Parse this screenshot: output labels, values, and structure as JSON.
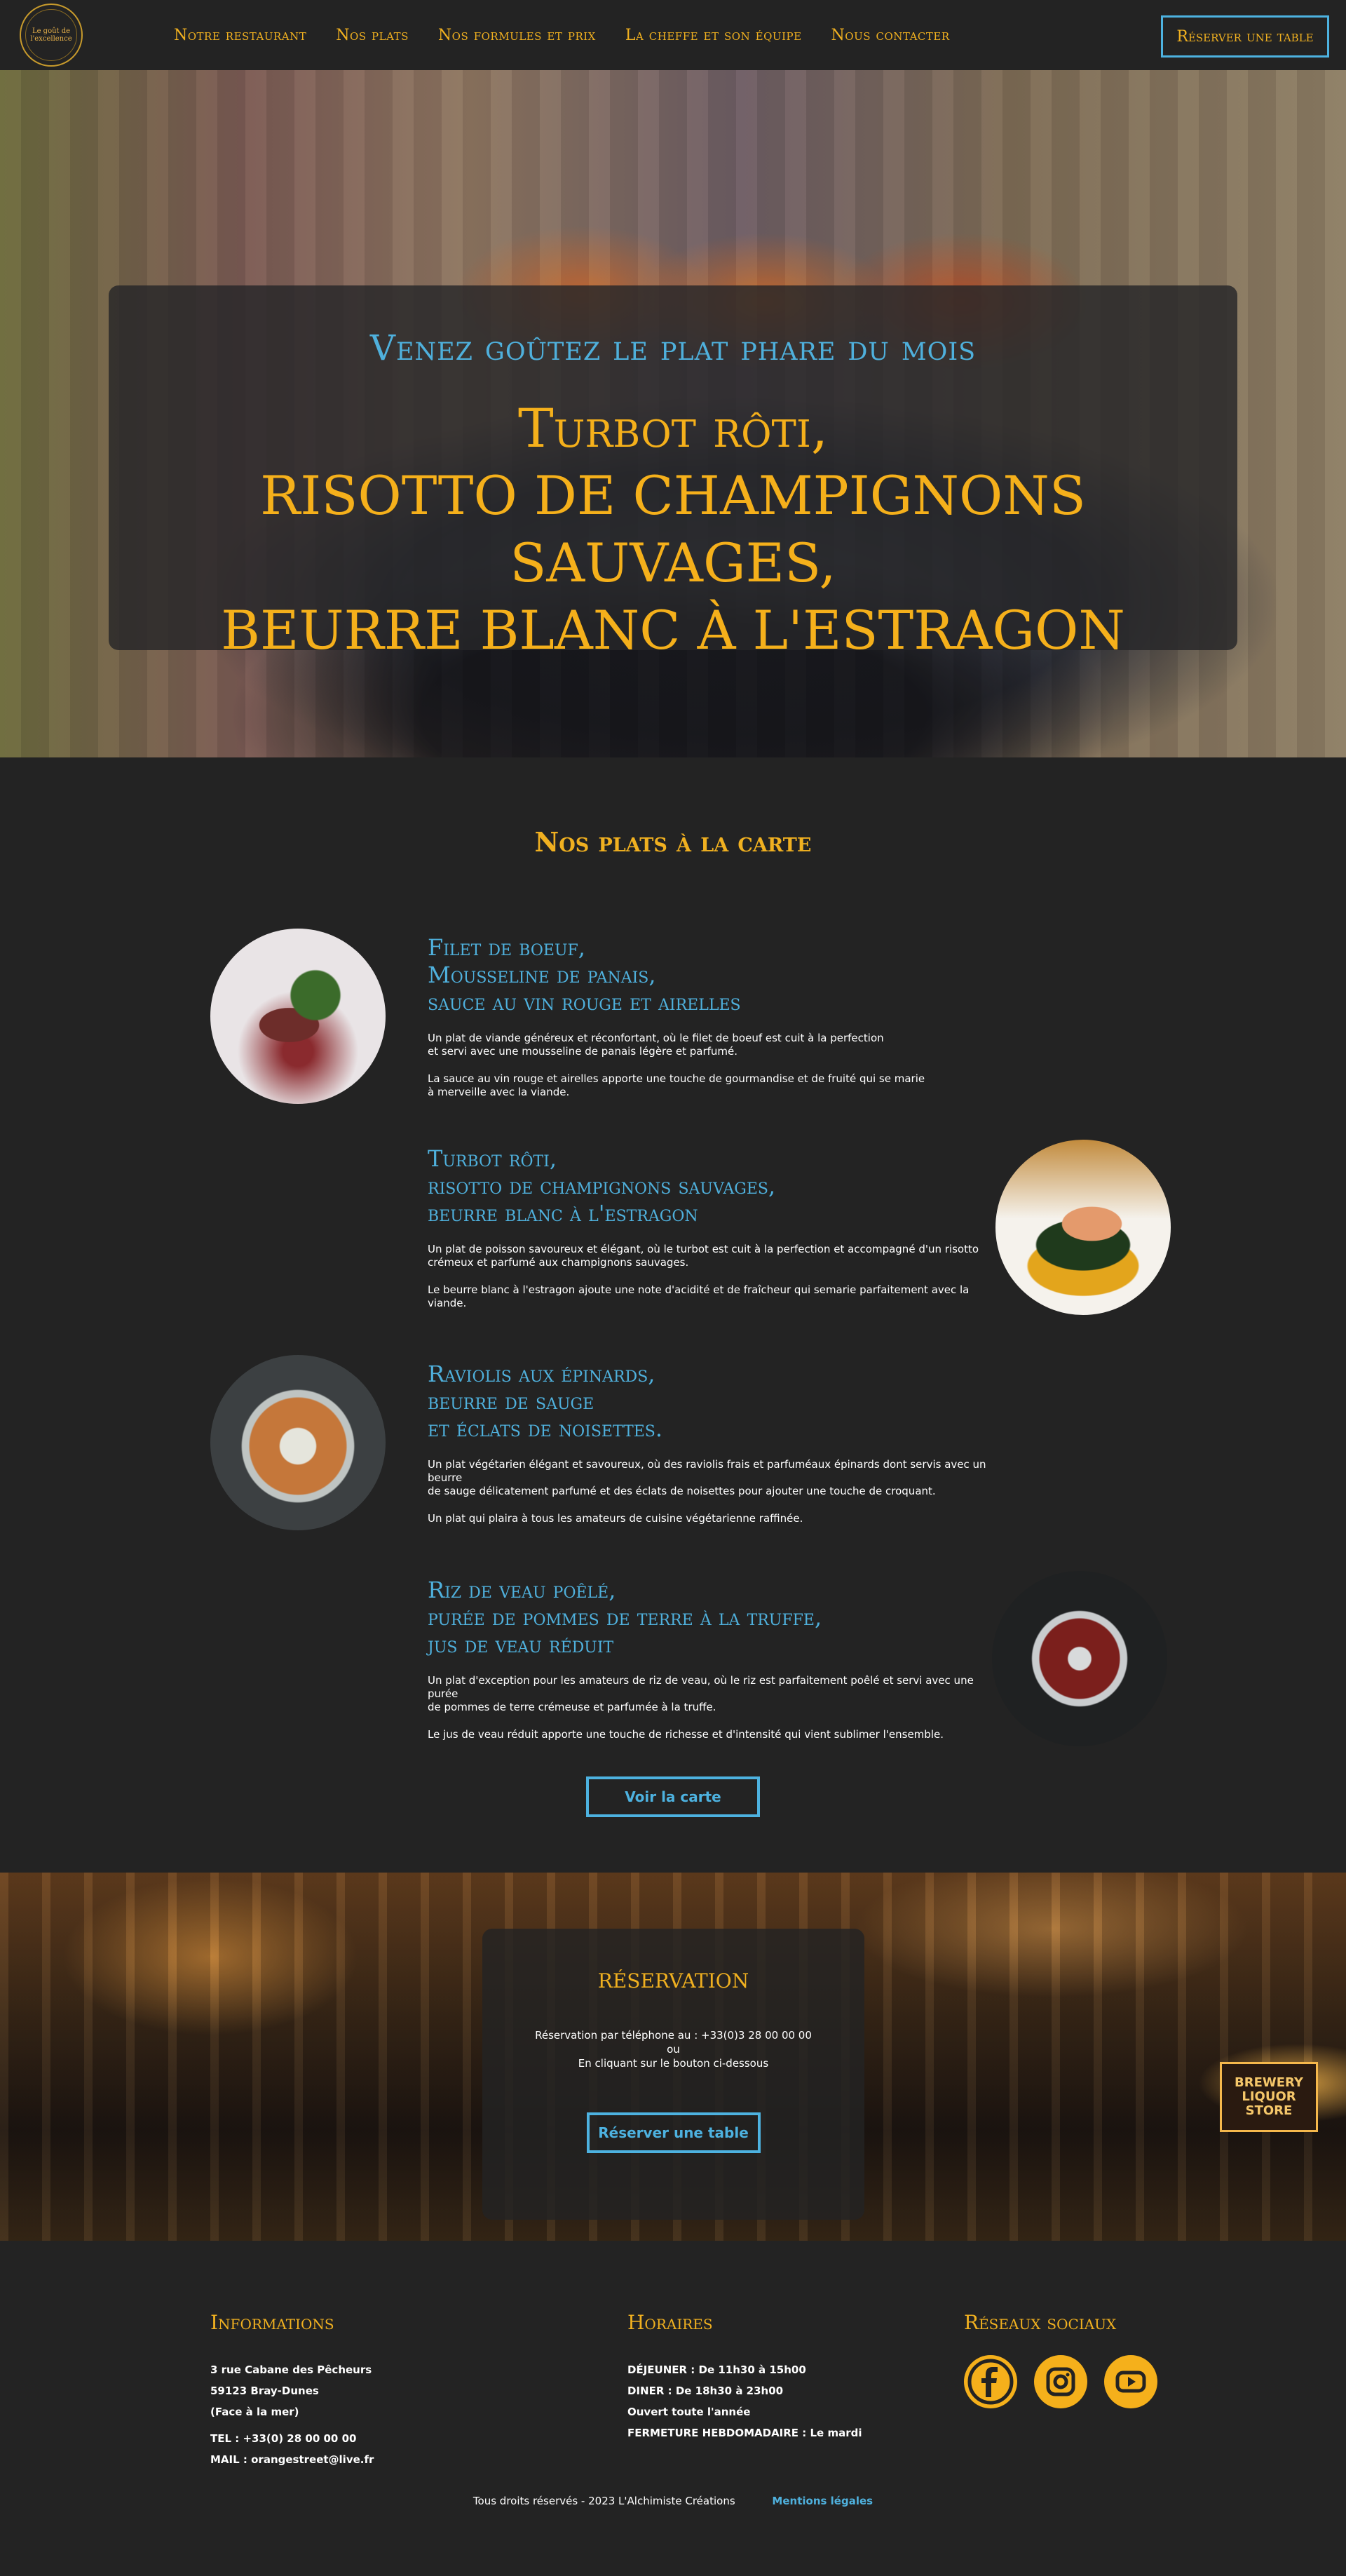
{
  "nav": {
    "logo_line1": "Le goût de",
    "logo_line2": "l'excellence",
    "links": [
      "Notre restaurant",
      "Nos plats",
      "Nos formules et prix",
      "La cheffe et son équipe",
      "Nous contacter"
    ],
    "cta": "Réserver une table"
  },
  "hero": {
    "subtitle": "Venez goûtez le plat phare du mois",
    "title_line1": "Turbot rôti,",
    "title_line2": "RISOTTO DE CHAMPIGNONS SAUVAGES,",
    "title_line3": "BEURRE BLANC À L'ESTRAGON"
  },
  "dishes": {
    "title": "Nos plats à la carte",
    "items": [
      {
        "name_line1": "Filet de boeuf,",
        "name_line2": "Mousseline de panais,",
        "name_line3": "sauce au vin rouge et airelles",
        "desc1": "Un plat de viande généreux et réconfortant, où le filet de boeuf est cuit à la perfection\net servi avec une mousseline de panais légère et parfumé.",
        "desc2": "La sauce au vin rouge et airelles apporte une touche de gourmandise et de fruité qui se marie\nà merveille avec la viande."
      },
      {
        "name_line1": "Turbot rôti,",
        "name_line2": "risotto de champignons sauvages,",
        "name_line3": "beurre blanc à l'estragon",
        "desc1": "Un plat de poisson savoureux et élégant, où le turbot est cuit à la perfection et accompagné d'un risotto\ncrémeux et parfumé aux champignons sauvages.",
        "desc2": "Le beurre blanc à l'estragon ajoute une note d'acidité et de fraîcheur qui semarie parfaitement avec la viande."
      },
      {
        "name_line1": "Raviolis aux épinards,",
        "name_line2": "beurre de sauge",
        "name_line3": "et éclats de noisettes.",
        "desc1": "Un plat végétarien élégant et savoureux, où des raviolis frais et parfuméaux épinards dont servis avec un beurre\nde sauge délicatement parfumé et des éclats de noisettes pour ajouter une touche de croquant.",
        "desc2": "Un plat qui plaira à tous les amateurs de cuisine végétarienne raffinée."
      },
      {
        "name_line1": "Riz de veau poêlé,",
        "name_line2": "purée de pommes de terre à la truffe,",
        "name_line3": "jus de veau réduit",
        "desc1": "Un plat d'exception pour les amateurs de riz de veau, où le riz est parfaitement poêlé et servi avec une purée\nde pommes de terre crémeuse et parfumée à la truffe.",
        "desc2": "Le jus de veau réduit apporte une touche de richesse et d'intensité qui vient sublimer l'ensemble."
      }
    ],
    "button": "Voir la carte"
  },
  "reservation": {
    "title": "réservation",
    "line1": "Réservation par téléphone au : +33(0)3 28 00 00 00",
    "line2": "ou",
    "line3": "En cliquant sur le bouton ci-dessous",
    "button": "Réserver une table",
    "sign": "BREWERY\nLIQUOR\nSTORE"
  },
  "footer": {
    "info": {
      "title": "Informations",
      "address1": "3 rue Cabane des Pêcheurs",
      "address2": "59123 Bray-Dunes",
      "address3": "(Face à la mer)",
      "tel": "TEL : +33(0) 28 00 00 00",
      "mail": "MAIL : orangestreet@live.fr"
    },
    "hours": {
      "title": "Horaires",
      "lunch": "DÉJEUNER : De 11h30 à 15h00",
      "dinner": "DINER : De 18h30 à 23h00",
      "open": "Ouvert toute l'année",
      "closing": "FERMETURE HEBDOMADAIRE : Le mardi"
    },
    "social": {
      "title": "Réseaux sociaux",
      "icons": [
        "facebook-icon",
        "instagram-icon",
        "youtube-icon"
      ]
    },
    "copyright": "Tous droits réservés - 2023 L'Alchimiste Créations",
    "legal": "Mentions légales"
  },
  "colors": {
    "gold": "#f0b020",
    "blue": "#4fb0dc",
    "background": "#232323"
  }
}
